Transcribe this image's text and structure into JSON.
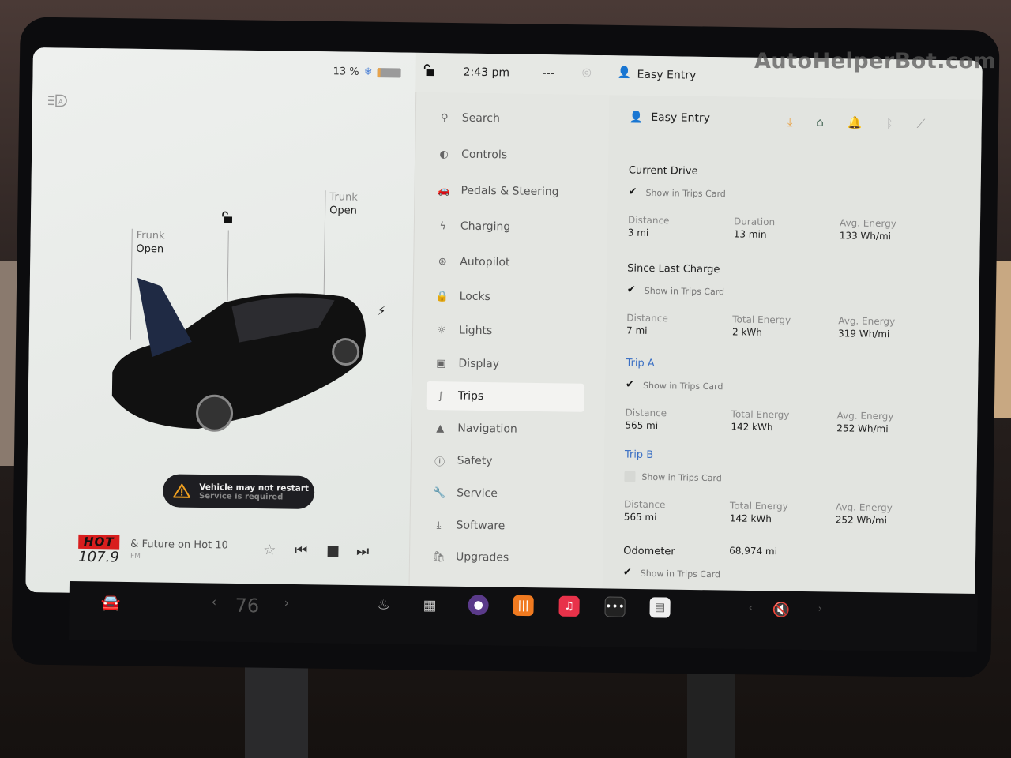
{
  "watermark": "AutoHelperBot.com",
  "status_bar": {
    "battery_percent": "13 %",
    "battery_level": 0.13,
    "time": "2:43 pm",
    "temp": "---",
    "profile_name": "Easy Entry"
  },
  "car_view": {
    "frunk": {
      "title": "Frunk",
      "state": "Open"
    },
    "trunk": {
      "title": "Trunk",
      "state": "Open"
    },
    "alert": {
      "line1": "Vehicle may not restart",
      "line2": "Service is required"
    }
  },
  "media": {
    "station_logo_top": "HOT",
    "station_logo_freq": "107.9",
    "song": "& Future on Hot 10",
    "band": "FM"
  },
  "menu": {
    "items": [
      {
        "label": "Search",
        "icon": "search-icon"
      },
      {
        "label": "Controls",
        "icon": "toggle-icon"
      },
      {
        "label": "Pedals & Steering",
        "icon": "car-icon"
      },
      {
        "label": "Charging",
        "icon": "bolt-icon"
      },
      {
        "label": "Autopilot",
        "icon": "steering-wheel-icon"
      },
      {
        "label": "Locks",
        "icon": "lock-icon"
      },
      {
        "label": "Lights",
        "icon": "sun-icon"
      },
      {
        "label": "Display",
        "icon": "display-icon"
      },
      {
        "label": "Trips",
        "icon": "route-icon",
        "active": true
      },
      {
        "label": "Navigation",
        "icon": "navigation-arrow-icon"
      },
      {
        "label": "Safety",
        "icon": "alert-circle-icon"
      },
      {
        "label": "Service",
        "icon": "wrench-icon"
      },
      {
        "label": "Software",
        "icon": "download-icon"
      },
      {
        "label": "Upgrades",
        "icon": "bag-icon"
      }
    ]
  },
  "trips": {
    "profile_name": "Easy Entry",
    "show_label": "Show in Trips Card",
    "current_drive": {
      "title": "Current Drive",
      "show": true,
      "stats": [
        {
          "label": "Distance",
          "value": "3 mi"
        },
        {
          "label": "Duration",
          "value": "13 min"
        },
        {
          "label": "Avg. Energy",
          "value": "133 Wh/mi"
        }
      ]
    },
    "since_last_charge": {
      "title": "Since Last Charge",
      "show": true,
      "stats": [
        {
          "label": "Distance",
          "value": "7 mi"
        },
        {
          "label": "Total Energy",
          "value": "2 kWh"
        },
        {
          "label": "Avg. Energy",
          "value": "319 Wh/mi"
        }
      ]
    },
    "trip_a": {
      "title": "Trip A",
      "show": true,
      "stats": [
        {
          "label": "Distance",
          "value": "565 mi"
        },
        {
          "label": "Total Energy",
          "value": "142 kWh"
        },
        {
          "label": "Avg. Energy",
          "value": "252 Wh/mi"
        }
      ]
    },
    "trip_b": {
      "title": "Trip B",
      "show": false,
      "stats": [
        {
          "label": "Distance",
          "value": "565 mi"
        },
        {
          "label": "Total Energy",
          "value": "142 kWh"
        },
        {
          "label": "Avg. Energy",
          "value": "252 Wh/mi"
        }
      ]
    },
    "odometer": {
      "label": "Odometer",
      "value": "68,974 mi",
      "show": true
    }
  },
  "taskbar": {
    "temperature": "76",
    "volume_state": "muted"
  },
  "colors": {
    "accent_blue": "#3a6fc4",
    "download_orange": "#e8a34a",
    "alert_orange": "#f0a020",
    "radio_red": "#d81e1e"
  }
}
